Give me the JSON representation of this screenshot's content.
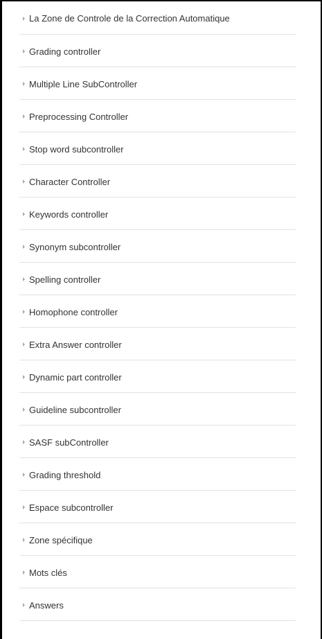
{
  "menu": {
    "items": [
      {
        "label": "La Zone de Controle de la Correction Automatique"
      },
      {
        "label": "Grading controller"
      },
      {
        "label": "Multiple Line SubController"
      },
      {
        "label": "Preprocessing Controller"
      },
      {
        "label": "Stop word subcontroller"
      },
      {
        "label": "Character Controller"
      },
      {
        "label": "Keywords controller"
      },
      {
        "label": "Synonym subcontroller"
      },
      {
        "label": "Spelling controller"
      },
      {
        "label": "Homophone controller"
      },
      {
        "label": "Extra Answer controller"
      },
      {
        "label": "Dynamic part controller"
      },
      {
        "label": "Guideline subcontroller"
      },
      {
        "label": "SASF subController"
      },
      {
        "label": "Grading threshold"
      },
      {
        "label": "Espace subcontroller"
      },
      {
        "label": "Zone spécifique"
      },
      {
        "label": "Mots clés"
      },
      {
        "label": "Answers"
      }
    ],
    "expand_icon": "triangle-right-icon"
  }
}
